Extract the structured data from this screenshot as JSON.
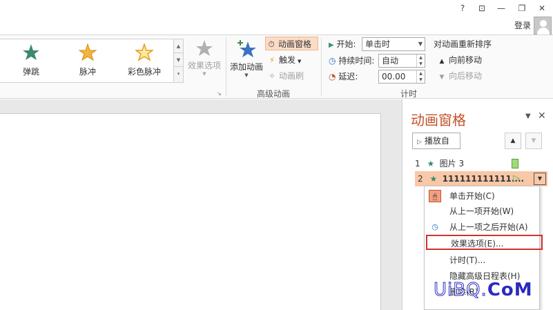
{
  "titlebar": {
    "help": "?",
    "ribbon_display": "⊡",
    "minimize": "—",
    "restore": "❐",
    "close": "✕",
    "login": "登录"
  },
  "ribbon": {
    "gallery": [
      {
        "label": "弹跳",
        "icon": "bounce-star-icon"
      },
      {
        "label": "脉冲",
        "icon": "pulse-star-icon"
      },
      {
        "label": "彩色脉冲",
        "icon": "color-pulse-star-icon"
      }
    ],
    "effect_options": "效果选项",
    "add_animation": "添加动画",
    "animation_pane": "动画窗格",
    "trigger": "触发",
    "animation_painter": "动画刷",
    "advanced_group": "高级动画",
    "start_label": "开始:",
    "start_value": "单击时",
    "duration_label": "持续时间:",
    "duration_value": "自动",
    "delay_label": "延迟:",
    "delay_value": "00.00",
    "timing_group": "计时",
    "reorder_title": "对动画重新排序",
    "move_earlier": "向前移动",
    "move_later": "向后移动"
  },
  "pane": {
    "title": "动画窗格",
    "play_from": "播放自",
    "items": [
      {
        "num": "1",
        "label": "图片 3"
      },
      {
        "num": "2",
        "label": "111111111111...."
      }
    ]
  },
  "menu": {
    "items": [
      "单击开始(C)",
      "从上一项开始(W)",
      "从上一项之后开始(A)",
      "效果选项(E)...",
      "计时(T)...",
      "隐藏高级日程表(H)",
      "删除(R)"
    ]
  },
  "watermark": {
    "left": "UiBQ.",
    "right": "CoM"
  },
  "colors": {
    "accent": "#c25128",
    "highlight": "#f8c8a8",
    "menu_highlight_border": "#d32f2f"
  }
}
